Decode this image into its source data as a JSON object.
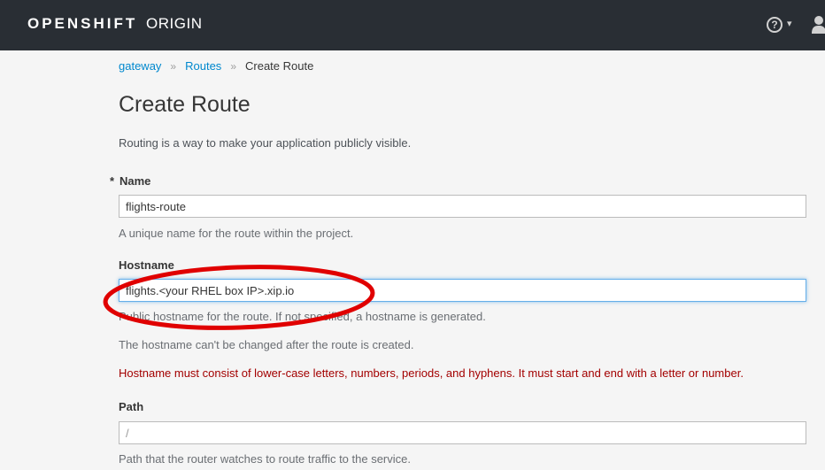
{
  "header": {
    "brand_bold": "OPENSHIFT",
    "brand_light": "ORIGIN",
    "help_glyph": "?",
    "caret_glyph": "▾",
    "bg_color": "#292e34"
  },
  "breadcrumb": {
    "items": [
      "gateway",
      "Routes"
    ],
    "separator": "»",
    "current": "Create Route"
  },
  "page": {
    "title": "Create Route",
    "intro": "Routing is a way to make your application publicly visible."
  },
  "form": {
    "required_marker": "*",
    "name": {
      "label": "Name",
      "value": "flights-route",
      "help": "A unique name for the route within the project."
    },
    "hostname": {
      "label": "Hostname",
      "value": "flights.<your RHEL box IP>.xip.io",
      "help1": "Public hostname for the route. If not specified, a hostname is generated.",
      "help2": "The hostname can't be changed after the route is created.",
      "error": "Hostname must consist of lower-case letters, numbers, periods, and hyphens. It must start and end with a letter or number."
    },
    "path": {
      "label": "Path",
      "placeholder": "/",
      "help": "Path that the router watches to route traffic to the service."
    }
  },
  "colors": {
    "link": "#0088ce",
    "error": "#a30000",
    "annotation": "#e00000",
    "focus": "#66afe9"
  }
}
